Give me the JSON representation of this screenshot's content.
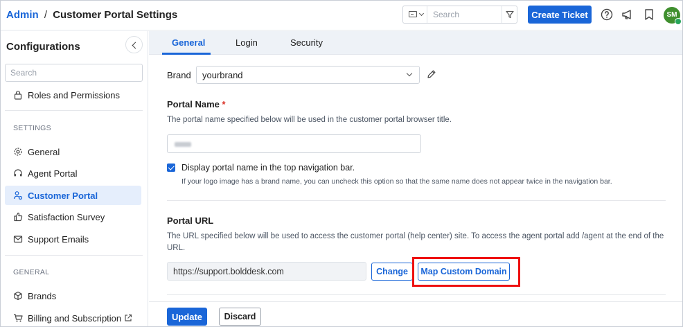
{
  "breadcrumb": {
    "root": "Admin",
    "separator": "/",
    "current": "Customer Portal Settings"
  },
  "topbar": {
    "search_placeholder": "Search",
    "create_ticket_label": "Create Ticket",
    "icons": [
      "card-icon",
      "chevron-down-icon",
      "filter-icon",
      "help-icon",
      "megaphone-icon",
      "bookmark-icon"
    ],
    "avatar_initials": "SM",
    "avatar_color": "#3f8f2e"
  },
  "sidebar": {
    "title": "Configurations",
    "search_placeholder": "Search",
    "items_top": [
      {
        "label": "Roles and Permissions",
        "icon": "lock-icon"
      }
    ],
    "section_settings": "SETTINGS",
    "items_settings": [
      {
        "label": "General",
        "icon": "gear-icon"
      },
      {
        "label": "Agent Portal",
        "icon": "headset-icon"
      },
      {
        "label": "Customer Portal",
        "icon": "user-gear-icon",
        "active": true
      },
      {
        "label": "Satisfaction Survey",
        "icon": "thumbs-up-icon"
      },
      {
        "label": "Support Emails",
        "icon": "mail-icon"
      }
    ],
    "section_general": "GENERAL",
    "items_general": [
      {
        "label": "Brands",
        "icon": "cube-icon"
      },
      {
        "label": "Billing and Subscription",
        "icon": "cart-icon",
        "external": true
      }
    ]
  },
  "tabs": [
    {
      "label": "General",
      "active": true
    },
    {
      "label": "Login"
    },
    {
      "label": "Security"
    }
  ],
  "form": {
    "brand_label": "Brand",
    "brand_value": "yourbrand",
    "portal_name_label": "Portal Name",
    "required_mark": "*",
    "portal_name_desc": "The portal name specified below will be used in the customer portal browser title.",
    "display_name_checkbox": "Display portal name in the top navigation bar.",
    "display_name_checked": true,
    "display_name_hint": "If your logo image has a brand name, you can uncheck this option so that the same name does not appear twice in the navigation bar.",
    "portal_url_label": "Portal URL",
    "portal_url_desc": "The URL specified below will be used to access the customer portal (help center) site. To access the agent portal add /agent at the end of the URL.",
    "portal_url_value": "https://support.bolddesk.com",
    "change_label": "Change",
    "map_domain_label": "Map Custom Domain"
  },
  "footer": {
    "update_label": "Update",
    "discard_label": "Discard"
  },
  "colors": {
    "accent": "#1a66d8",
    "highlight": "#ee1111",
    "active_bg": "#e5eefc"
  }
}
